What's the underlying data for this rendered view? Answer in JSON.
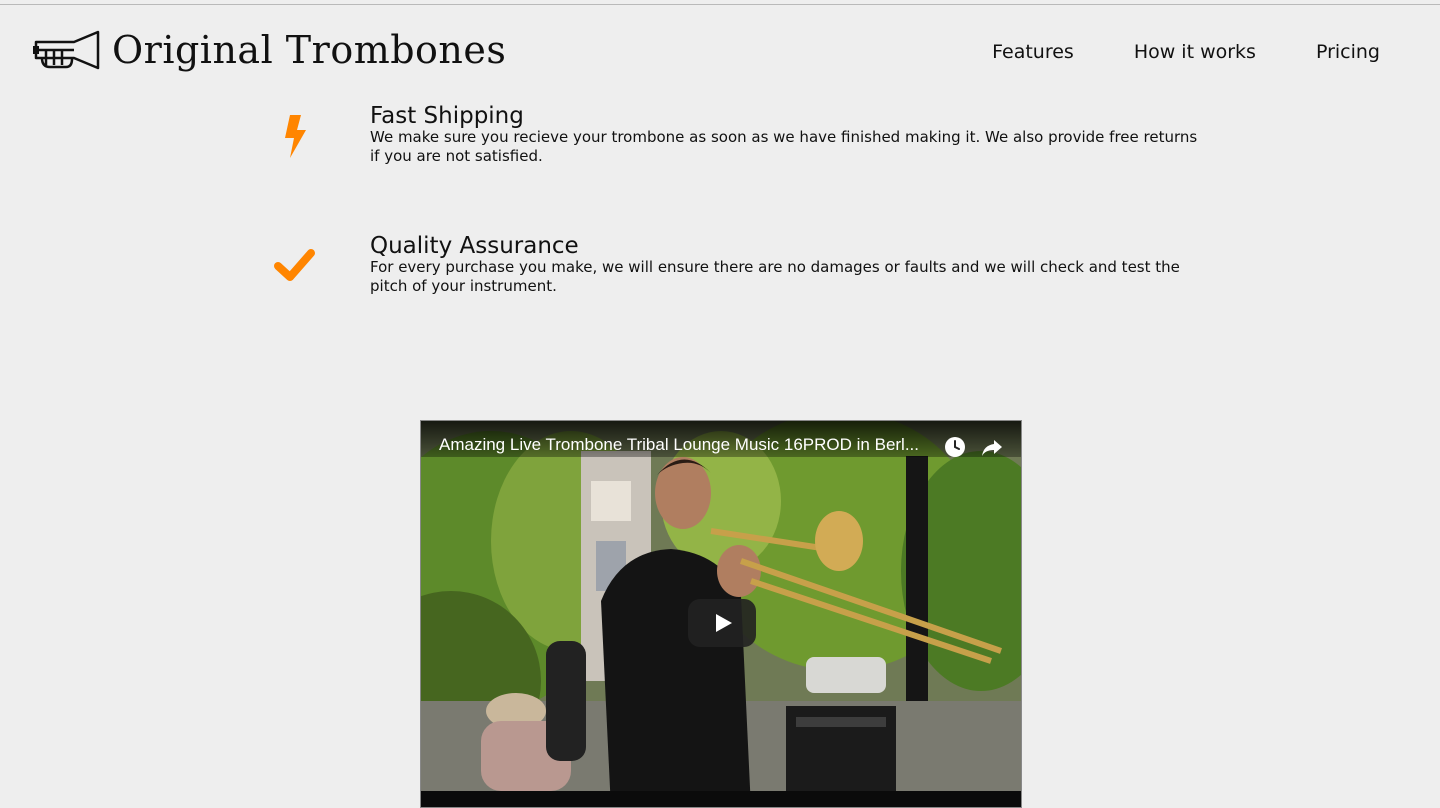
{
  "brand": {
    "name": "Original Trombones",
    "logo_icon": "trumpet-icon"
  },
  "nav": {
    "items": [
      "Features",
      "How it works",
      "Pricing"
    ]
  },
  "features": [
    {
      "icon": "lightning-bolt-icon",
      "title": "Fast Shipping",
      "text": "We make sure you recieve your trombone as soon as we have finished making it. We also provide free returns if you are not satisfied."
    },
    {
      "icon": "checkmark-icon",
      "title": "Quality Assurance",
      "text": "For every purchase you make, we will ensure there are no damages or faults and we will check and test the pitch of your instrument."
    }
  ],
  "video": {
    "title": "Amazing Live Trombone Tribal Lounge Music 16PROD in Berl...",
    "watch_later_icon": "clock-icon",
    "share_icon": "share-arrow-icon",
    "play_icon": "play-icon"
  },
  "colors": {
    "accent": "#ff8500",
    "background": "#eeeeee",
    "text": "#111111"
  }
}
